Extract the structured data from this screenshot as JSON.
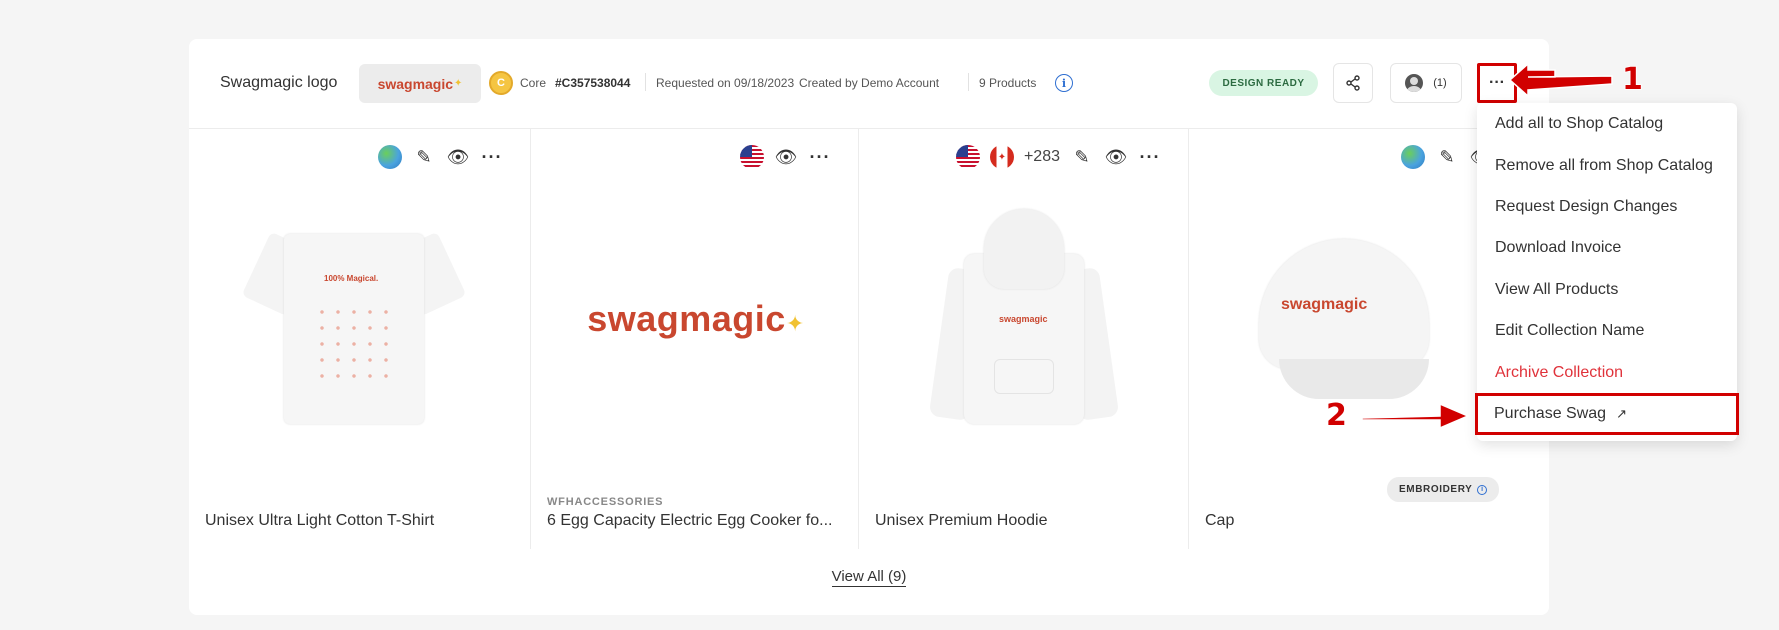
{
  "header": {
    "title": "Swagmagic logo",
    "logo_text": "swagmagic",
    "tier": "Core",
    "collection_id": "#C357538044",
    "requested": "Requested on 09/18/2023",
    "created_by": "Created by Demo Account",
    "product_count": "9 Products",
    "status_badge": "DESIGN READY",
    "users_count": "(1)",
    "more_label": "···"
  },
  "products": [
    {
      "name": "Unisex Ultra Light Cotton T-Shirt",
      "vendor": "",
      "print": "100% Magical.",
      "icons": [
        "globe-icon",
        "edit-icon",
        "eye-icon",
        "more-icon"
      ]
    },
    {
      "name": "6 Egg Capacity Electric Egg Cooker fo...",
      "vendor": "WFHACCESSORIES",
      "print": "swagmagic",
      "icons": [
        "us-flag-icon",
        "eye-icon",
        "more-icon"
      ]
    },
    {
      "name": "Unisex Premium Hoodie",
      "vendor": "",
      "print": "swagmagic",
      "extra_countries": "+283",
      "icons": [
        "us-flag-icon",
        "canada-flag-icon",
        "edit-icon",
        "eye-icon",
        "more-icon"
      ]
    },
    {
      "name": "Cap",
      "vendor": "",
      "print": "swagmagic",
      "badge": "EMBROIDERY",
      "icons": [
        "globe-icon",
        "edit-icon",
        "eye-icon"
      ]
    }
  ],
  "view_all": "View All (9)",
  "menu": {
    "items": [
      {
        "label": "Add all to Shop Catalog"
      },
      {
        "label": "Remove all from Shop Catalog"
      },
      {
        "label": "Request Design Changes"
      },
      {
        "label": "Download Invoice"
      },
      {
        "label": "View All Products"
      },
      {
        "label": "Edit Collection Name"
      },
      {
        "label": "Archive Collection"
      },
      {
        "label": "Purchase Swag"
      }
    ]
  },
  "annotations": {
    "one": "1",
    "two": "2"
  },
  "colors": {
    "brand": "#c9472f",
    "annotation": "#d10000",
    "danger": "#e0323a",
    "ready_bg": "#d9f5e3"
  }
}
